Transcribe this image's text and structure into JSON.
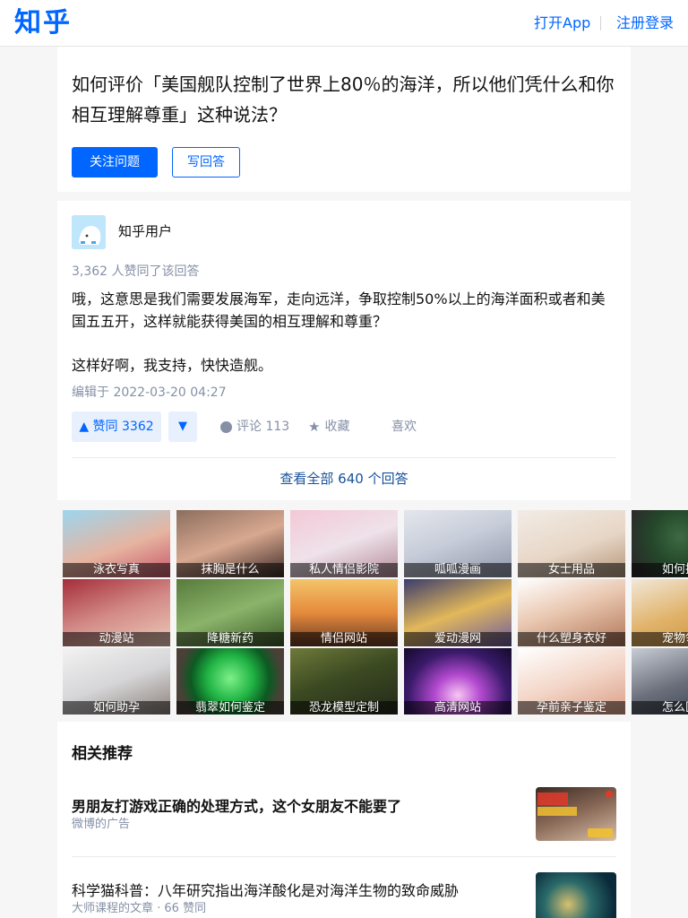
{
  "header": {
    "logo": "知乎",
    "open_app": "打开App",
    "login": "注册登录",
    "brand_color": "#0066ff"
  },
  "question": {
    "title": "如何评价「美国舰队控制了世界上80％的海洋，所以他们凭什么和你相互理解尊重」这种说法？",
    "follow_label": "关注问题",
    "write_answer_label": "写回答"
  },
  "answer": {
    "author": "知乎用户",
    "avatar_icon": "default-user-avatar",
    "upvote_summary": "3,362 人赞同了该回答",
    "paragraphs": [
      "哦，这意思是我们需要发展海军，走向远洋，争取控制50%以上的海洋面积或者和美国五五开，这样就能获得美国的相互理解和尊重？",
      "这样好啊，我支持，快快造舰。"
    ],
    "edited": "编辑于 2022-03-20 04:27",
    "vote_up_label": "▲ 赞同 3362",
    "vote_down_label": "▼",
    "comment_label": "评论 113",
    "collect_label": "收藏",
    "like_label": "喜欢"
  },
  "view_all": "查看全部 640 个回答",
  "ad_tiles": [
    {
      "label": "泳衣写真"
    },
    {
      "label": "抹胸是什么"
    },
    {
      "label": "私人情侣影院"
    },
    {
      "label": "呱呱漫画"
    },
    {
      "label": "女士用品"
    },
    {
      "label": "如何挑选"
    },
    {
      "label": "动漫站"
    },
    {
      "label": "降糖新药"
    },
    {
      "label": "情侣网站"
    },
    {
      "label": "爱动漫网"
    },
    {
      "label": "什么塑身衣好"
    },
    {
      "label": "宠物领养"
    },
    {
      "label": "如何助孕"
    },
    {
      "label": "翡翠如何鉴定"
    },
    {
      "label": "恐龙模型定制"
    },
    {
      "label": "高清网站"
    },
    {
      "label": "孕前亲子鉴定"
    },
    {
      "label": "怎么区分"
    }
  ],
  "related": {
    "title": "相关推荐",
    "items": [
      {
        "title": "男朋友打游戏正确的处理方式，这个女朋友不能要了",
        "meta": "微博的广告"
      },
      {
        "title": "科学猫科普：八年研究指出海洋酸化是对海洋生物的致命威胁",
        "meta": "大师课程的文章 · 66 赞同"
      }
    ]
  }
}
